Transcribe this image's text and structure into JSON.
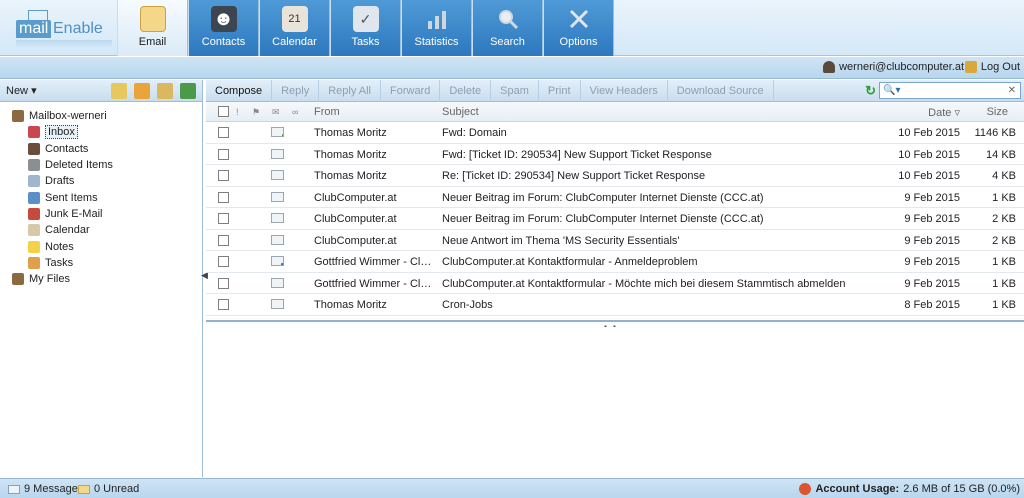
{
  "app": {
    "logo_a": "mail",
    "logo_b": "Enable"
  },
  "nav": [
    {
      "label": "Email",
      "icon": "envelope-icon",
      "active": true
    },
    {
      "label": "Contacts",
      "icon": "person-icon"
    },
    {
      "label": "Calendar",
      "icon": "calendar-icon"
    },
    {
      "label": "Tasks",
      "icon": "clipboard-icon"
    },
    {
      "label": "Statistics",
      "icon": "bar-chart-icon"
    },
    {
      "label": "Search",
      "icon": "magnifier-icon"
    },
    {
      "label": "Options",
      "icon": "tools-icon"
    }
  ],
  "userbar": {
    "user": "werneri@clubcomputer.at",
    "logout": "Log Out"
  },
  "left": {
    "new_label": "New",
    "mailbox": "Mailbox-werneri",
    "folders": [
      "Inbox",
      "Contacts",
      "Deleted Items",
      "Drafts",
      "Sent Items",
      "Junk E-Mail",
      "Calendar",
      "Notes",
      "Tasks"
    ],
    "my_files": "My Files"
  },
  "toolbar": {
    "compose": "Compose",
    "reply": "Reply",
    "reply_all": "Reply All",
    "forward": "Forward",
    "delete": "Delete",
    "spam": "Spam",
    "print": "Print",
    "view_headers": "View Headers",
    "download_source": "Download Source"
  },
  "listhead": {
    "from": "From",
    "subject": "Subject",
    "date": "Date",
    "size": "Size"
  },
  "messages": [
    {
      "from": "Thomas Moritz",
      "subject": "Fwd: Domain",
      "date": "10 Feb 2015",
      "size": "1146 KB",
      "flag": "new"
    },
    {
      "from": "Thomas Moritz",
      "subject": "Fwd: [Ticket ID: 290534] New Support Ticket Response",
      "date": "10 Feb 2015",
      "size": "14 KB",
      "flag": ""
    },
    {
      "from": "Thomas Moritz",
      "subject": "Re: [Ticket ID: 290534] New Support Ticket Response",
      "date": "10 Feb 2015",
      "size": "4 KB",
      "flag": ""
    },
    {
      "from": "ClubComputer.at",
      "subject": "Neuer Beitrag im Forum: ClubComputer Internet Dienste (CCC.at)",
      "date": "9 Feb 2015",
      "size": "1 KB",
      "flag": ""
    },
    {
      "from": "ClubComputer.at",
      "subject": "Neuer Beitrag im Forum: ClubComputer Internet Dienste (CCC.at)",
      "date": "9 Feb 2015",
      "size": "2 KB",
      "flag": ""
    },
    {
      "from": "ClubComputer.at",
      "subject": "Neue Antwort im Thema 'MS Security Essentials'",
      "date": "9 Feb 2015",
      "size": "2 KB",
      "flag": ""
    },
    {
      "from": "Gottfried Wimmer - ClubC...",
      "subject": "ClubComputer.at Kontaktformular - Anmeldeproblem",
      "date": "9 Feb 2015",
      "size": "1 KB",
      "flag": "fwd"
    },
    {
      "from": "Gottfried Wimmer - ClubC...",
      "subject": "ClubComputer.at Kontaktformular - Möchte mich bei diesem Stammtisch abmelden",
      "date": "9 Feb 2015",
      "size": "1 KB",
      "flag": ""
    },
    {
      "from": "Thomas Moritz",
      "subject": "Cron-Jobs",
      "date": "8 Feb 2015",
      "size": "1 KB",
      "flag": ""
    }
  ],
  "status": {
    "messages": "9 Messages",
    "unread": "0 Unread",
    "usage_label": "Account Usage:",
    "usage_value": "2.6 MB of 15 GB (0.0%)"
  },
  "colors": {
    "accent": "#2d78bf",
    "bar": "#cfe4f5",
    "selected": "#e8f0f8"
  }
}
